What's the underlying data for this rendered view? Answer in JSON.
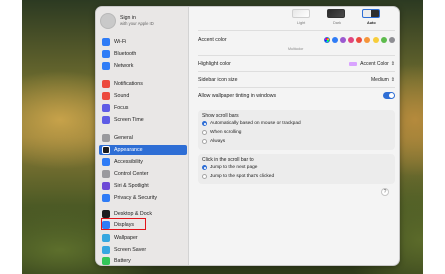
{
  "account": {
    "title": "Sign in",
    "subtitle": "with your Apple ID"
  },
  "sidebar": {
    "items": [
      {
        "label": "Wi-Fi",
        "icon": "wifi-icon",
        "color": "#2f7cf6"
      },
      {
        "label": "Bluetooth",
        "icon": "bluetooth-icon",
        "color": "#2f7cf6"
      },
      {
        "label": "Network",
        "icon": "network-icon",
        "color": "#2f7cf6"
      },
      {
        "label": "Notifications",
        "icon": "notifications-icon",
        "color": "#ec4a3d"
      },
      {
        "label": "Sound",
        "icon": "sound-icon",
        "color": "#ec4a3d"
      },
      {
        "label": "Focus",
        "icon": "focus-icon",
        "color": "#5e5ce6"
      },
      {
        "label": "Screen Time",
        "icon": "screen-time-icon",
        "color": "#5e5ce6"
      },
      {
        "label": "General",
        "icon": "gear-icon",
        "color": "#9a9a9e"
      },
      {
        "label": "Appearance",
        "icon": "appearance-icon",
        "color": "#1c1c1e"
      },
      {
        "label": "Accessibility",
        "icon": "accessibility-icon",
        "color": "#2f7cf6"
      },
      {
        "label": "Control Center",
        "icon": "control-center-icon",
        "color": "#9a9a9e"
      },
      {
        "label": "Siri & Spotlight",
        "icon": "siri-icon",
        "color": "#6e4ad6"
      },
      {
        "label": "Privacy & Security",
        "icon": "privacy-icon",
        "color": "#2f7cf6"
      },
      {
        "label": "Desktop & Dock",
        "icon": "desktop-dock-icon",
        "color": "#1c1c1e"
      },
      {
        "label": "Displays",
        "icon": "displays-icon",
        "color": "#2f7cf6"
      },
      {
        "label": "Wallpaper",
        "icon": "wallpaper-icon",
        "color": "#36a7e0"
      },
      {
        "label": "Screen Saver",
        "icon": "screen-saver-icon",
        "color": "#36a7e0"
      },
      {
        "label": "Battery",
        "icon": "battery-icon",
        "color": "#34c759"
      }
    ]
  },
  "appearance": {
    "themes": [
      {
        "label": "Light"
      },
      {
        "label": "Dark"
      },
      {
        "label": "Auto"
      }
    ],
    "accent_label": "Accent color",
    "accent_colors": [
      "#8a8a8e",
      "#2f7cf6",
      "#9b59d0",
      "#e0467d",
      "#ec4a3d",
      "#f5953a",
      "#f7cd3a",
      "#5dbb4c",
      "#8e8e93"
    ],
    "multicolor_label": "Multicolor",
    "highlight_label": "Highlight color",
    "highlight_value": "Accent Color",
    "sidebar_icon_label": "Sidebar icon size",
    "sidebar_icon_value": "Medium",
    "tinting_label": "Allow wallpaper tinting in windows",
    "tinting_on": true,
    "scroll_title": "Show scroll bars",
    "scroll_options": [
      "Automatically based on mouse or trackpad",
      "When scrolling",
      "Always"
    ],
    "click_title": "Click in the scroll bar to",
    "click_options": [
      "Jump to the next page",
      "Jump to the spot that's clicked"
    ],
    "help_label": "?"
  }
}
